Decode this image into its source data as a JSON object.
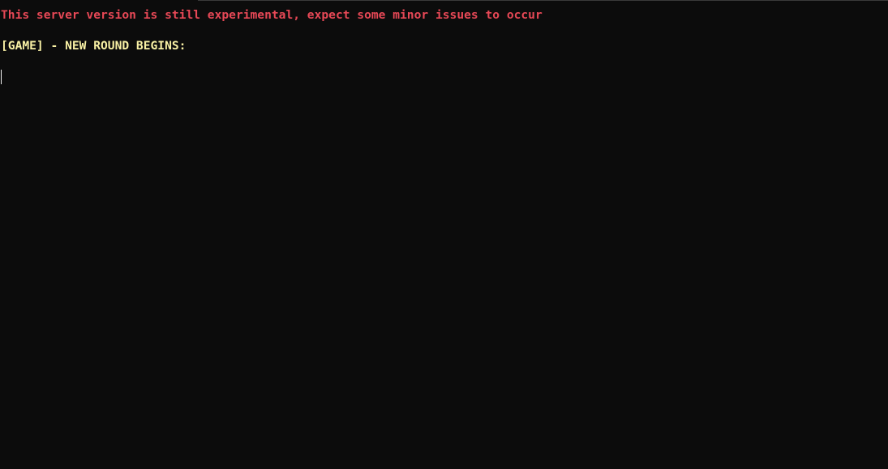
{
  "terminal": {
    "lines": [
      {
        "text": "This server version is still experimental, expect some minor issues to occur",
        "color": "#e74856",
        "kind": "warning"
      },
      {
        "text": "[GAME] - NEW ROUND BEGINS:",
        "color": "#f9f1a5",
        "kind": "game-event"
      }
    ],
    "background": "#0c0c0c",
    "cursor_color": "#f2f2f2"
  }
}
